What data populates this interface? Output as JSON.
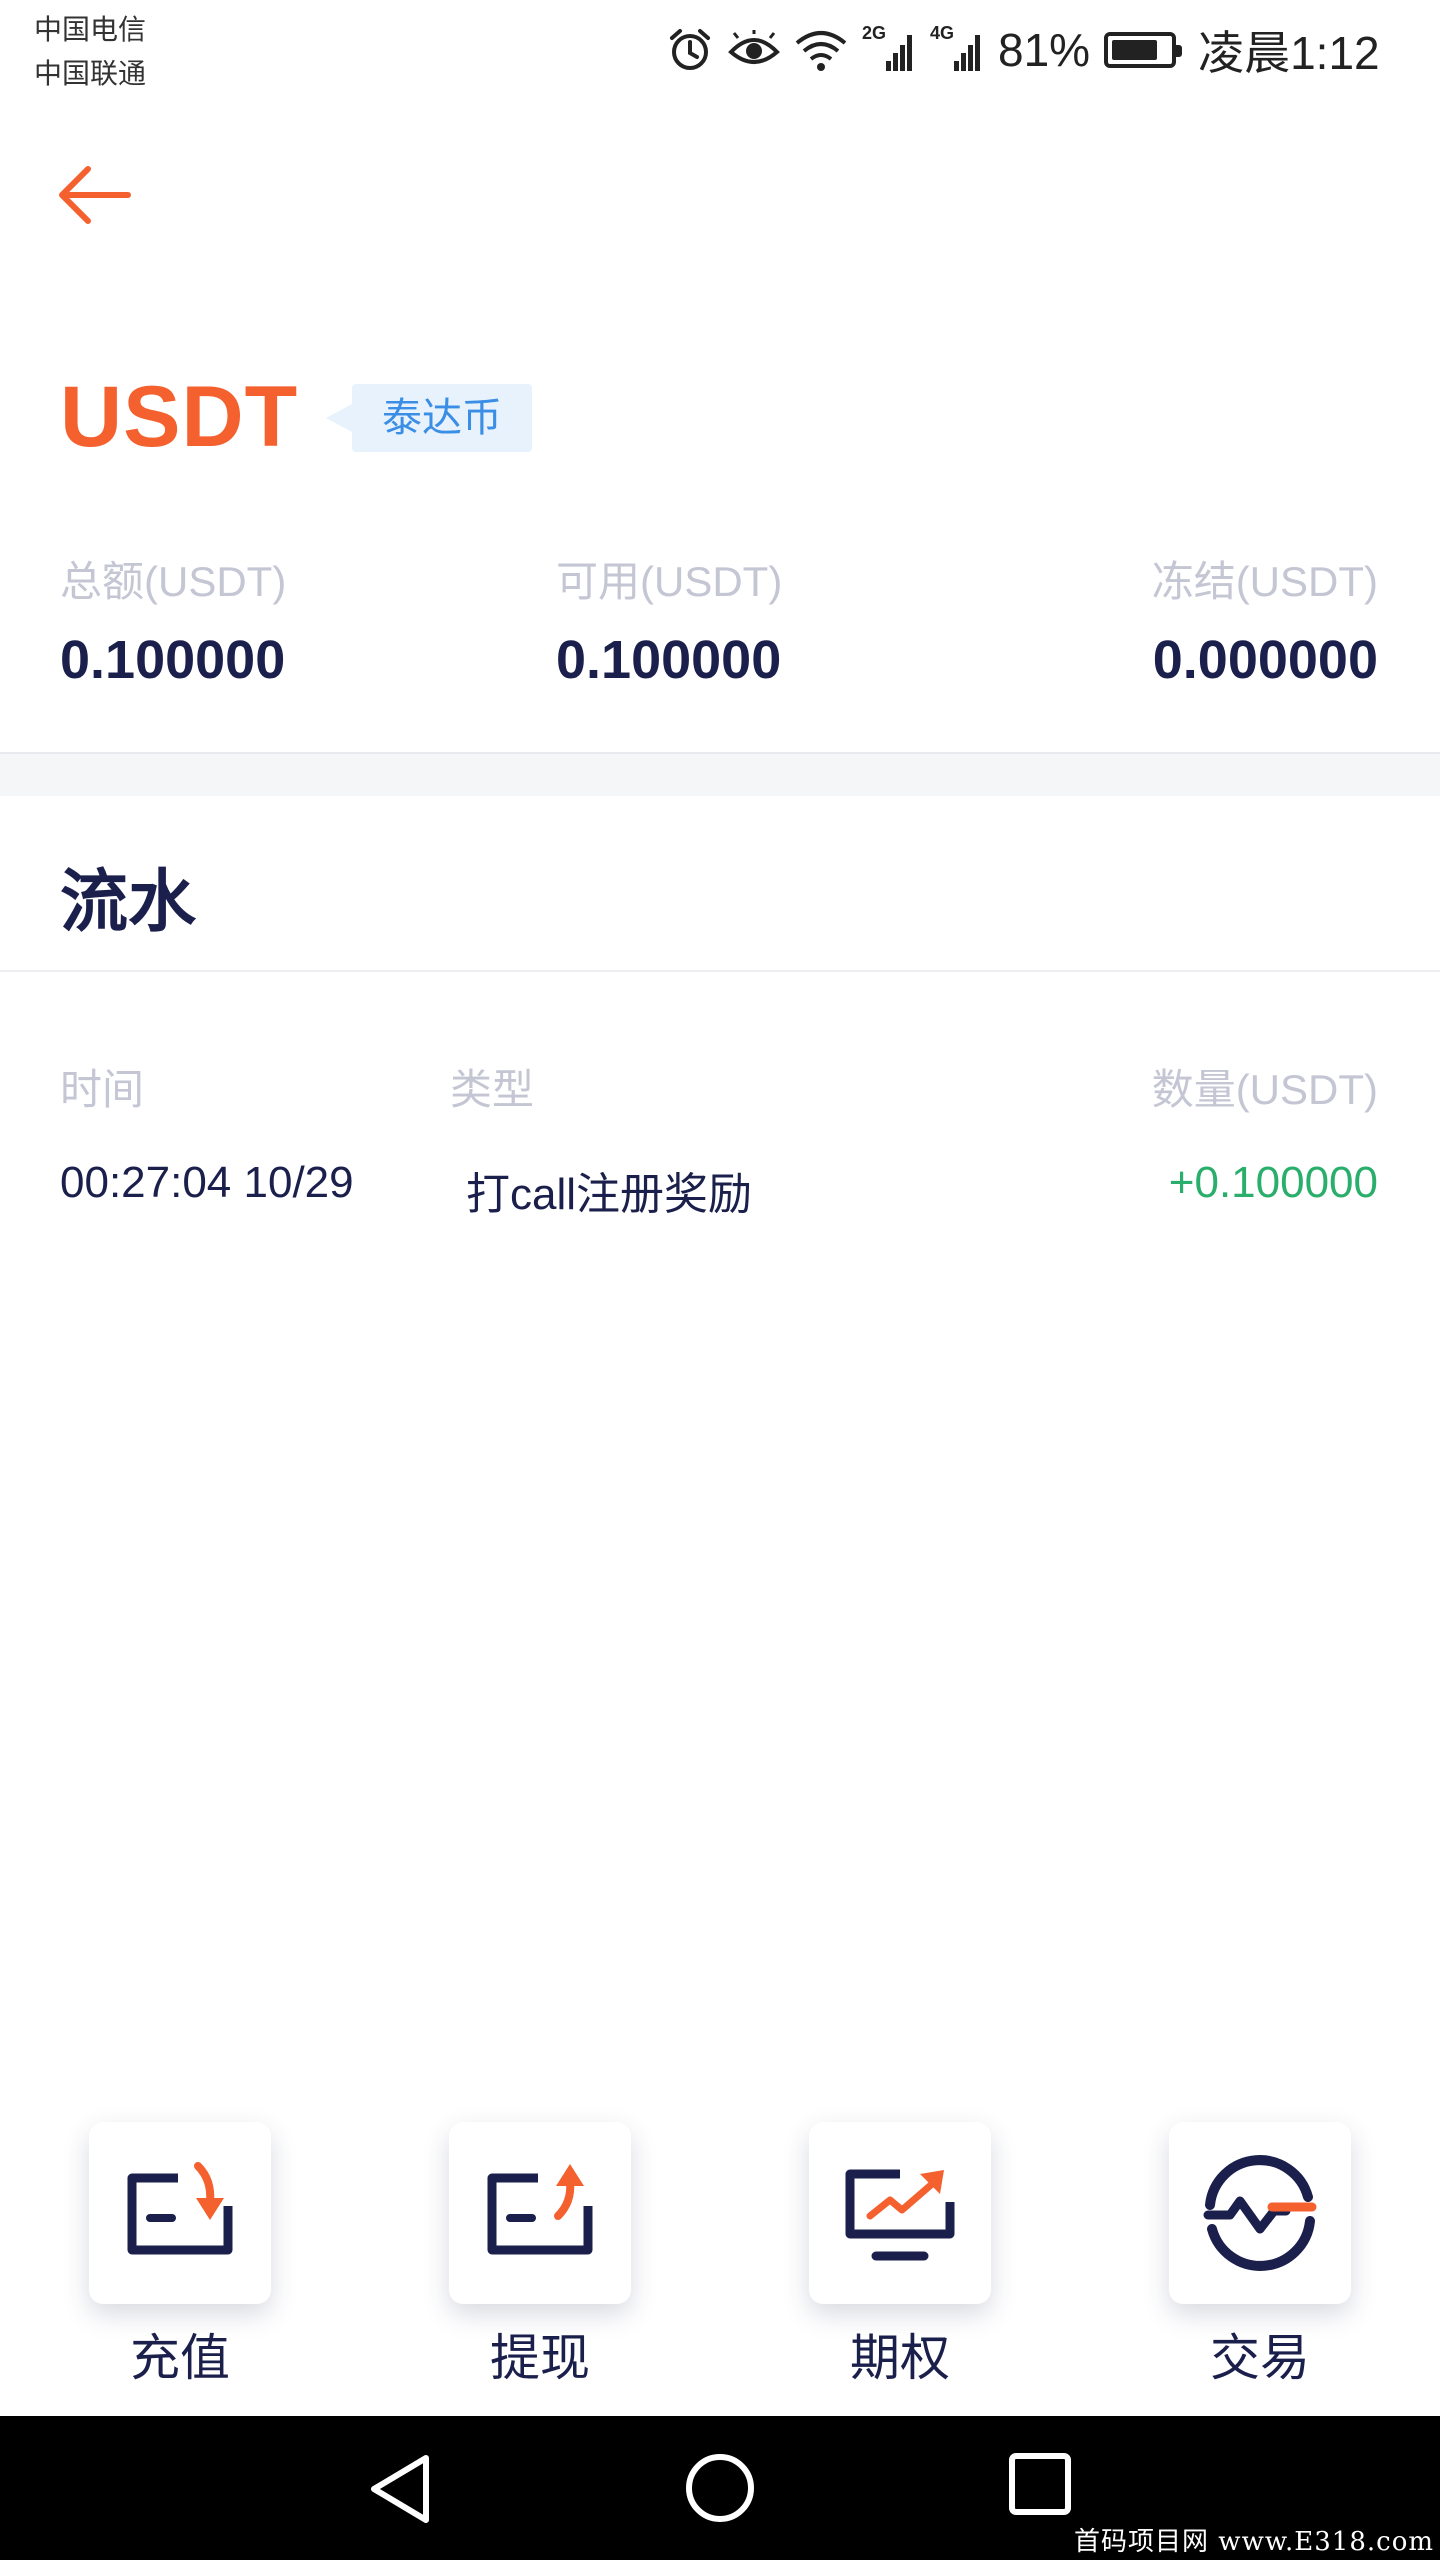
{
  "status_bar": {
    "carrier_1": "中国电信",
    "carrier_2": "中国联通",
    "signal_1_tag": "2G",
    "signal_2_tag": "4G",
    "battery_percent": "81%",
    "battery_level": 0.81,
    "time": "凌晨1:12"
  },
  "header": {
    "back_icon": "arrow-left-icon",
    "coin_name": "USDT",
    "coin_tag": "泰达币"
  },
  "balances": {
    "total_label": "总额(USDT)",
    "total_value": "0.100000",
    "available_label": "可用(USDT)",
    "available_value": "0.100000",
    "frozen_label": "冻结(USDT)",
    "frozen_value": "0.000000"
  },
  "flow": {
    "title": "流水",
    "columns": [
      "时间",
      "类型",
      "数量(USDT)"
    ],
    "rows": [
      {
        "time": "00:27:04 10/29",
        "type": "打call注册奖励",
        "amount": "+0.100000"
      }
    ]
  },
  "actions": [
    {
      "label": "充值",
      "icon": "deposit-icon"
    },
    {
      "label": "提现",
      "icon": "withdraw-icon"
    },
    {
      "label": "期权",
      "icon": "options-chart-icon"
    },
    {
      "label": "交易",
      "icon": "trade-icon"
    }
  ],
  "nav": {
    "back_icon": "triangle-back-icon",
    "home_icon": "circle-home-icon",
    "recents_icon": "square-recents-icon"
  },
  "watermark": "首码项目网 www.E318.com",
  "colors": {
    "accent": "#f4602e",
    "primary_text": "#1b1f4b",
    "muted_text": "#c4c6d4",
    "positive": "#2aae6b",
    "tag_bg": "#e8f2fc",
    "tag_text": "#3a8ee6"
  }
}
